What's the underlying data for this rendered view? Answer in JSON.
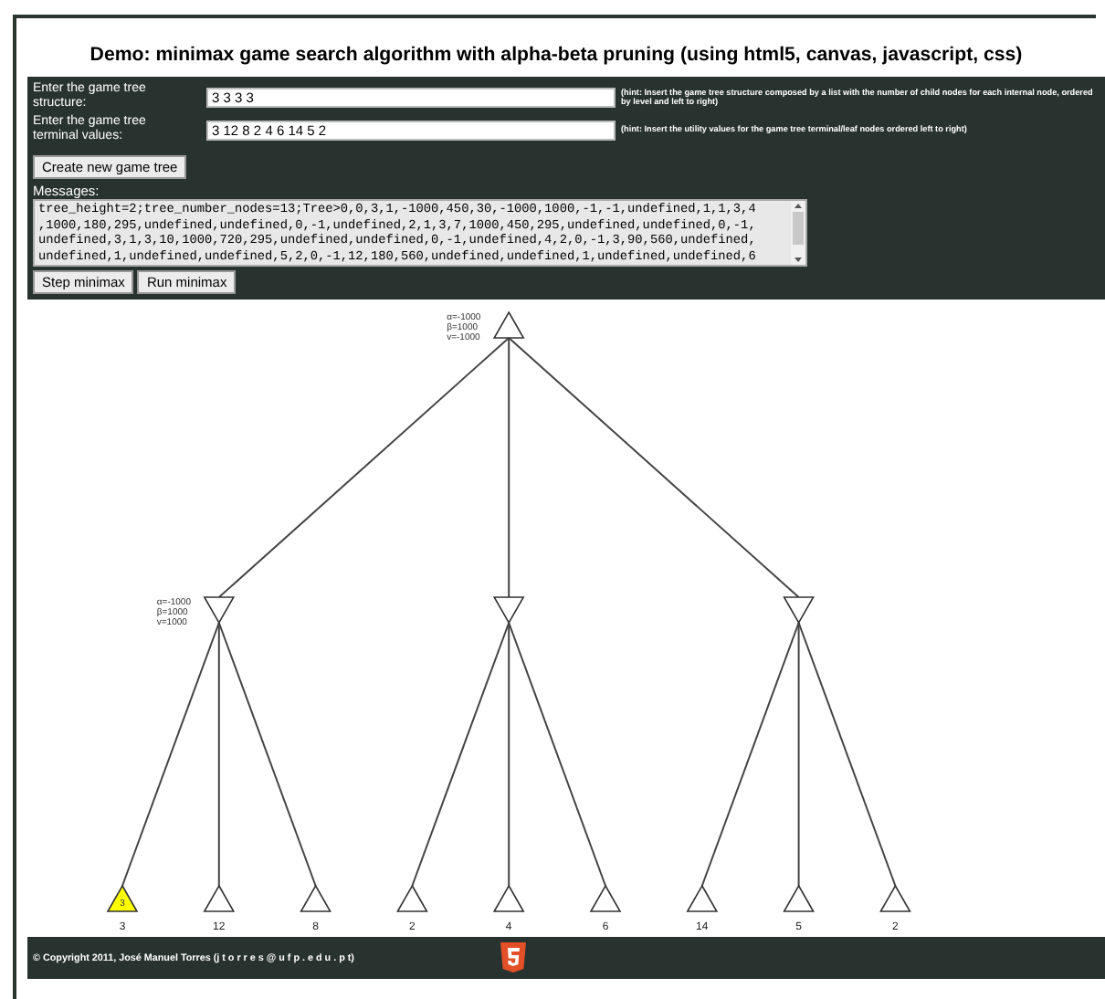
{
  "title": "Demo: minimax game search algorithm with alpha-beta pruning (using html5, canvas, javascript, css)",
  "fields": [
    {
      "label": "Enter the game tree structure:",
      "value": "3 3 3 3",
      "hint": "(hint: Insert the game tree structure composed by a list with the number of child nodes for each internal node, ordered by level and left to right)"
    },
    {
      "label": "Enter the game tree terminal values:",
      "value": "3 12 8 2 4 6 14 5 2",
      "hint": "(hint: Insert the utility values for the game tree terminal/leaf nodes ordered left to right)"
    }
  ],
  "create_button": "Create new game tree",
  "messages_label": "Messages:",
  "messages": [
    "tree_height=2;tree_number_nodes=13;Tree>0,0,3,1,-1000,450,30,-1000,1000,-1,-1,undefined,1,1,3,4",
    ",1000,180,295,undefined,undefined,0,-1,undefined,2,1,3,7,1000,450,295,undefined,undefined,0,-1,",
    "undefined,3,1,3,10,1000,720,295,undefined,undefined,0,-1,undefined,4,2,0,-1,3,90,560,undefined,",
    "undefined,1,undefined,undefined,5,2,0,-1,12,180,560,undefined,undefined,1,undefined,undefined,6"
  ],
  "buttons": [
    "Step minimax",
    "Run minimax"
  ],
  "tree": {
    "kind": "max",
    "annotation": [
      "α=-1000",
      "β=1000",
      "v=-1000"
    ],
    "children": [
      {
        "kind": "min",
        "annotation": [
          "α=-1000",
          "β=1000",
          "v=1000"
        ],
        "children": [
          {
            "kind": "leaf",
            "value": "3",
            "inner": "3",
            "highlighted": true
          },
          {
            "kind": "leaf",
            "value": "12",
            "highlighted": false
          },
          {
            "kind": "leaf",
            "value": "8",
            "highlighted": false
          }
        ]
      },
      {
        "kind": "min",
        "children": [
          {
            "kind": "leaf",
            "value": "2",
            "highlighted": false
          },
          {
            "kind": "leaf",
            "value": "4",
            "highlighted": false
          },
          {
            "kind": "leaf",
            "value": "6",
            "highlighted": false
          }
        ]
      },
      {
        "kind": "min",
        "children": [
          {
            "kind": "leaf",
            "value": "14",
            "highlighted": false
          },
          {
            "kind": "leaf",
            "value": "5",
            "highlighted": false
          },
          {
            "kind": "leaf",
            "value": "2",
            "highlighted": false
          }
        ]
      }
    ]
  },
  "footer": "© Copyright 2011, José Manuel Torres (j t o r r e s @ u f p . e d u . p t)"
}
